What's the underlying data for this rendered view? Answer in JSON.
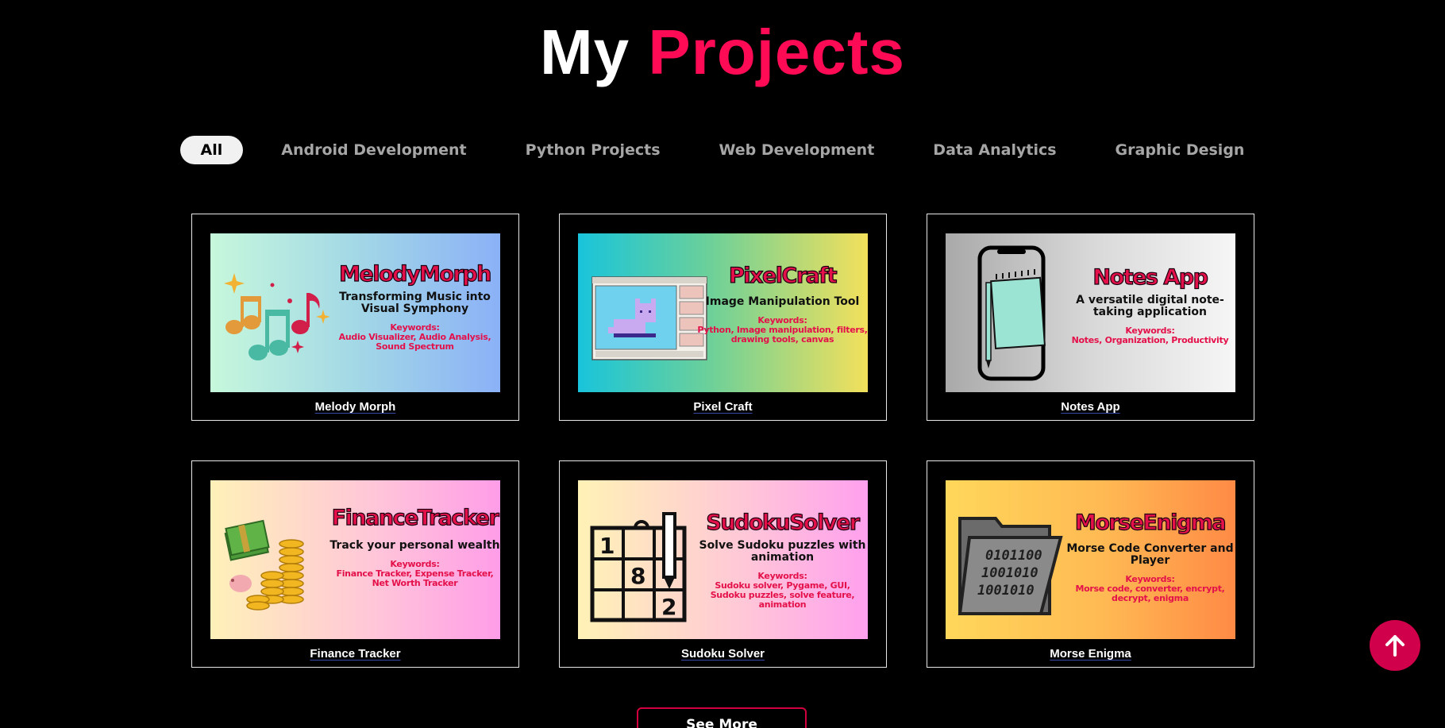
{
  "header": {
    "title_plain": "My",
    "title_accent": "Projects"
  },
  "filters": [
    {
      "label": "All",
      "active": true
    },
    {
      "label": "Android Development",
      "active": false
    },
    {
      "label": "Python Projects",
      "active": false
    },
    {
      "label": "Web Development",
      "active": false
    },
    {
      "label": "Data Analytics",
      "active": false
    },
    {
      "label": "Graphic Design",
      "active": false
    }
  ],
  "projects": [
    {
      "name": "Melody Morph",
      "thumb_title": "MelodyMorph",
      "thumb_subtitle": "Transforming Music into Visual Symphony",
      "keywords_label": "Keywords:",
      "keywords": "Audio Visualizer, Audio Analysis, Sound Spectrum",
      "icon": "music-notes-icon"
    },
    {
      "name": "Pixel Craft",
      "thumb_title": "PixelCraft",
      "thumb_subtitle": "Image Manipulation Tool",
      "keywords_label": "Keywords:",
      "keywords": "Python, Image manipulation, filters, drawing tools, canvas",
      "icon": "pixel-cat-window-icon"
    },
    {
      "name": "Notes App",
      "thumb_title": "Notes App",
      "thumb_subtitle": "A versatile digital note-taking application",
      "keywords_label": "Keywords:",
      "keywords": "Notes, Organization, Productivity",
      "icon": "phone-notepad-icon"
    },
    {
      "name": "Finance Tracker",
      "thumb_title": "FinanceTracker",
      "thumb_subtitle": "Track your personal wealth",
      "keywords_label": "Keywords:",
      "keywords": "Finance Tracker, Expense Tracker, Net Worth Tracker",
      "icon": "money-coins-icon"
    },
    {
      "name": "Sudoku Solver",
      "thumb_title": "SudokuSolver",
      "thumb_subtitle": "Solve Sudoku puzzles with animation",
      "keywords_label": "Keywords:",
      "keywords": "Sudoku solver, Pygame, GUI, Sudoku puzzles, solve feature, animation",
      "icon": "sudoku-grid-icon",
      "grid_digits": [
        "1",
        "8",
        "2"
      ]
    },
    {
      "name": "Morse Enigma",
      "thumb_title": "MorseEnigma",
      "thumb_subtitle": "Morse Code Converter and Player",
      "keywords_label": "Keywords:",
      "keywords": "Morse code, converter, encrypt, decrypt, enigma",
      "icon": "binary-folder-icon",
      "folder_lines": [
        "0101100",
        "1001010",
        "1001010"
      ]
    }
  ],
  "see_more": "See More",
  "scroll_top_icon": "arrow-up-icon",
  "colors": {
    "accent": "#ff0b55",
    "background": "#000000",
    "scroll_button": "#d1004a"
  }
}
